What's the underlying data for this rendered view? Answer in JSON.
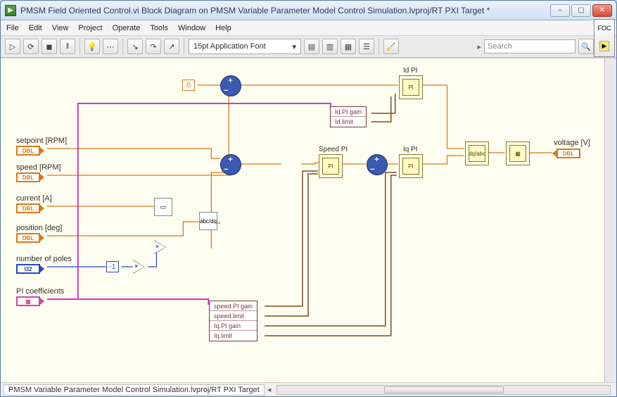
{
  "window": {
    "title": "PMSM Field Oriented Control.vi Block Diagram on PMSM Variable Parameter Model Control Simulation.lvproj/RT PXI Target *"
  },
  "menu": {
    "file": "File",
    "edit": "Edit",
    "view": "View",
    "project": "Project",
    "operate": "Operate",
    "tools": "Tools",
    "window": "Window",
    "help": "Help"
  },
  "toolbar": {
    "font": "15pt Application Font",
    "search_placeholder": "Search"
  },
  "statusbar": {
    "path": "PMSM Variable Parameter Model Control Simulation.lvproj/RT PXI Target"
  },
  "labels": {
    "setpoint": "setpoint [RPM]",
    "speed": "speed [RPM]",
    "current": "current [A]",
    "position": "position [deg]",
    "poles": "number of poles",
    "pi_coeff": "PI coefficients",
    "voltage": "voltage [V]",
    "id_pi": "Id PI",
    "speed_pi": "Speed PI",
    "iq_pi": "Iq PI"
  },
  "consts": {
    "zero": "0",
    "neg1": "-1"
  },
  "type": {
    "dbl": "DBL",
    "i32": "I32"
  },
  "unbundle_id": {
    "r0": "Id.PI gain",
    "r1": "Id.limit"
  },
  "unbundle_main": {
    "r0": "speed.PI gain",
    "r1": "speed.limit",
    "r2": "Iq.PI gain",
    "r3": "Iq.limit"
  },
  "vi": {
    "pi": "PI",
    "abc_dq": "abc/dq",
    "dq_abc": "dq/abc",
    "build": "▭",
    "mul": "×"
  },
  "iconpanel": {
    "top": "FOC",
    "bot": "▶"
  }
}
